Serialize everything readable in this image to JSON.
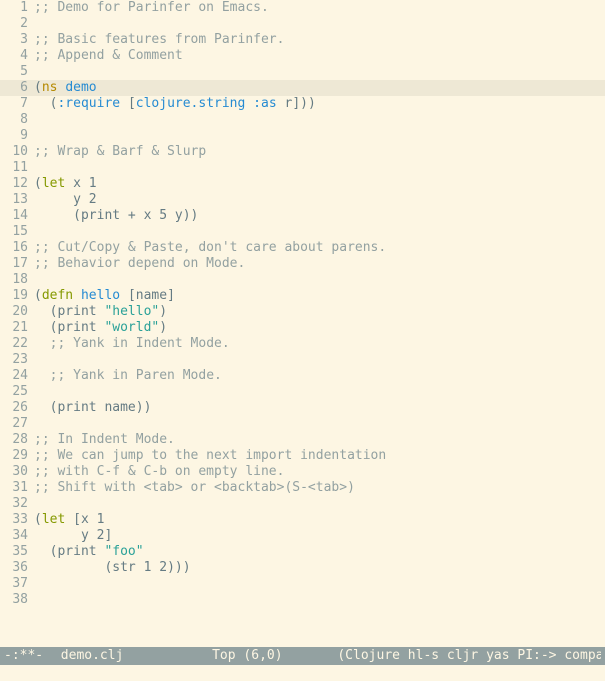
{
  "cursor": {
    "line": 6,
    "col": 0
  },
  "highlighted_line": 6,
  "lines": [
    {
      "n": 1,
      "tokens": [
        {
          "cls": "comment",
          "t": ";; Demo for Parinfer on Emacs."
        }
      ]
    },
    {
      "n": 2,
      "tokens": []
    },
    {
      "n": 3,
      "tokens": [
        {
          "cls": "comment",
          "t": ";; Basic features from Parinfer."
        }
      ]
    },
    {
      "n": 4,
      "tokens": [
        {
          "cls": "comment",
          "t": ";; Append & Comment"
        }
      ]
    },
    {
      "n": 5,
      "tokens": []
    },
    {
      "n": 6,
      "tokens": [
        {
          "cls": "paren",
          "t": "("
        },
        {
          "cls": "builtin",
          "t": "ns"
        },
        {
          "cls": "plain",
          "t": " "
        },
        {
          "cls": "sym",
          "t": "demo"
        }
      ]
    },
    {
      "n": 7,
      "tokens": [
        {
          "cls": "plain",
          "t": "  "
        },
        {
          "cls": "paren",
          "t": "("
        },
        {
          "cls": "kwcolon",
          "t": ":require"
        },
        {
          "cls": "plain",
          "t": " "
        },
        {
          "cls": "paren",
          "t": "["
        },
        {
          "cls": "sym",
          "t": "clojure.string"
        },
        {
          "cls": "plain",
          "t": " "
        },
        {
          "cls": "kwcolon",
          "t": ":as"
        },
        {
          "cls": "plain",
          "t": " r"
        },
        {
          "cls": "paren",
          "t": "]))"
        }
      ]
    },
    {
      "n": 8,
      "tokens": []
    },
    {
      "n": 9,
      "tokens": []
    },
    {
      "n": 10,
      "tokens": [
        {
          "cls": "comment",
          "t": ";; Wrap & Barf & Slurp"
        }
      ]
    },
    {
      "n": 11,
      "tokens": []
    },
    {
      "n": 12,
      "tokens": [
        {
          "cls": "paren",
          "t": "("
        },
        {
          "cls": "keyword",
          "t": "let"
        },
        {
          "cls": "plain",
          "t": " x 1"
        }
      ]
    },
    {
      "n": 13,
      "tokens": [
        {
          "cls": "plain",
          "t": "     y 2"
        }
      ]
    },
    {
      "n": 14,
      "tokens": [
        {
          "cls": "plain",
          "t": "     "
        },
        {
          "cls": "paren",
          "t": "("
        },
        {
          "cls": "plain",
          "t": "print + x 5 y"
        },
        {
          "cls": "paren",
          "t": "))"
        }
      ]
    },
    {
      "n": 15,
      "tokens": []
    },
    {
      "n": 16,
      "tokens": [
        {
          "cls": "comment",
          "t": ";; Cut/Copy & Paste, don't care about parens."
        }
      ]
    },
    {
      "n": 17,
      "tokens": [
        {
          "cls": "comment",
          "t": ";; Behavior depend on Mode."
        }
      ]
    },
    {
      "n": 18,
      "tokens": []
    },
    {
      "n": 19,
      "tokens": [
        {
          "cls": "paren",
          "t": "("
        },
        {
          "cls": "keyword",
          "t": "defn"
        },
        {
          "cls": "plain",
          "t": " "
        },
        {
          "cls": "sym",
          "t": "hello"
        },
        {
          "cls": "plain",
          "t": " "
        },
        {
          "cls": "paren",
          "t": "["
        },
        {
          "cls": "plain",
          "t": "name"
        },
        {
          "cls": "paren",
          "t": "]"
        }
      ]
    },
    {
      "n": 20,
      "tokens": [
        {
          "cls": "plain",
          "t": "  "
        },
        {
          "cls": "paren",
          "t": "("
        },
        {
          "cls": "plain",
          "t": "print "
        },
        {
          "cls": "str",
          "t": "\"hello\""
        },
        {
          "cls": "paren",
          "t": ")"
        }
      ]
    },
    {
      "n": 21,
      "tokens": [
        {
          "cls": "plain",
          "t": "  "
        },
        {
          "cls": "paren",
          "t": "("
        },
        {
          "cls": "plain",
          "t": "print "
        },
        {
          "cls": "str",
          "t": "\"world\""
        },
        {
          "cls": "paren",
          "t": ")"
        }
      ]
    },
    {
      "n": 22,
      "tokens": [
        {
          "cls": "plain",
          "t": "  "
        },
        {
          "cls": "comment",
          "t": ";; Yank in Indent Mode."
        }
      ]
    },
    {
      "n": 23,
      "tokens": []
    },
    {
      "n": 24,
      "tokens": [
        {
          "cls": "plain",
          "t": "  "
        },
        {
          "cls": "comment",
          "t": ";; Yank in Paren Mode."
        }
      ]
    },
    {
      "n": 25,
      "tokens": []
    },
    {
      "n": 26,
      "tokens": [
        {
          "cls": "plain",
          "t": "  "
        },
        {
          "cls": "paren",
          "t": "("
        },
        {
          "cls": "plain",
          "t": "print name"
        },
        {
          "cls": "paren",
          "t": "))"
        }
      ]
    },
    {
      "n": 27,
      "tokens": []
    },
    {
      "n": 28,
      "tokens": [
        {
          "cls": "comment",
          "t": ";; In Indent Mode."
        }
      ]
    },
    {
      "n": 29,
      "tokens": [
        {
          "cls": "comment",
          "t": ";; We can jump to the next import indentation"
        }
      ]
    },
    {
      "n": 30,
      "tokens": [
        {
          "cls": "comment",
          "t": ";; with C-f & C-b on empty line."
        }
      ]
    },
    {
      "n": 31,
      "tokens": [
        {
          "cls": "comment",
          "t": ";; Shift with <tab> or <backtab>(S-<tab>)"
        }
      ]
    },
    {
      "n": 32,
      "tokens": []
    },
    {
      "n": 33,
      "tokens": [
        {
          "cls": "paren",
          "t": "("
        },
        {
          "cls": "keyword",
          "t": "let"
        },
        {
          "cls": "plain",
          "t": " "
        },
        {
          "cls": "paren",
          "t": "["
        },
        {
          "cls": "plain",
          "t": "x 1"
        }
      ]
    },
    {
      "n": 34,
      "tokens": [
        {
          "cls": "plain",
          "t": "      y 2"
        },
        {
          "cls": "paren",
          "t": "]"
        }
      ]
    },
    {
      "n": 35,
      "tokens": [
        {
          "cls": "plain",
          "t": "  "
        },
        {
          "cls": "paren",
          "t": "("
        },
        {
          "cls": "plain",
          "t": "print "
        },
        {
          "cls": "str",
          "t": "\"foo\""
        }
      ]
    },
    {
      "n": 36,
      "tokens": [
        {
          "cls": "plain",
          "t": "         "
        },
        {
          "cls": "paren",
          "t": "("
        },
        {
          "cls": "plain",
          "t": "str 1 2"
        },
        {
          "cls": "paren",
          "t": ")))"
        }
      ]
    },
    {
      "n": 37,
      "tokens": []
    },
    {
      "n": 38,
      "tokens": []
    }
  ],
  "modeline": {
    "status": "-:**-",
    "filename": "demo.clj",
    "position": "Top (6,0)",
    "modes": "(Clojure hl-s cljr yas PI:-> company "
  }
}
